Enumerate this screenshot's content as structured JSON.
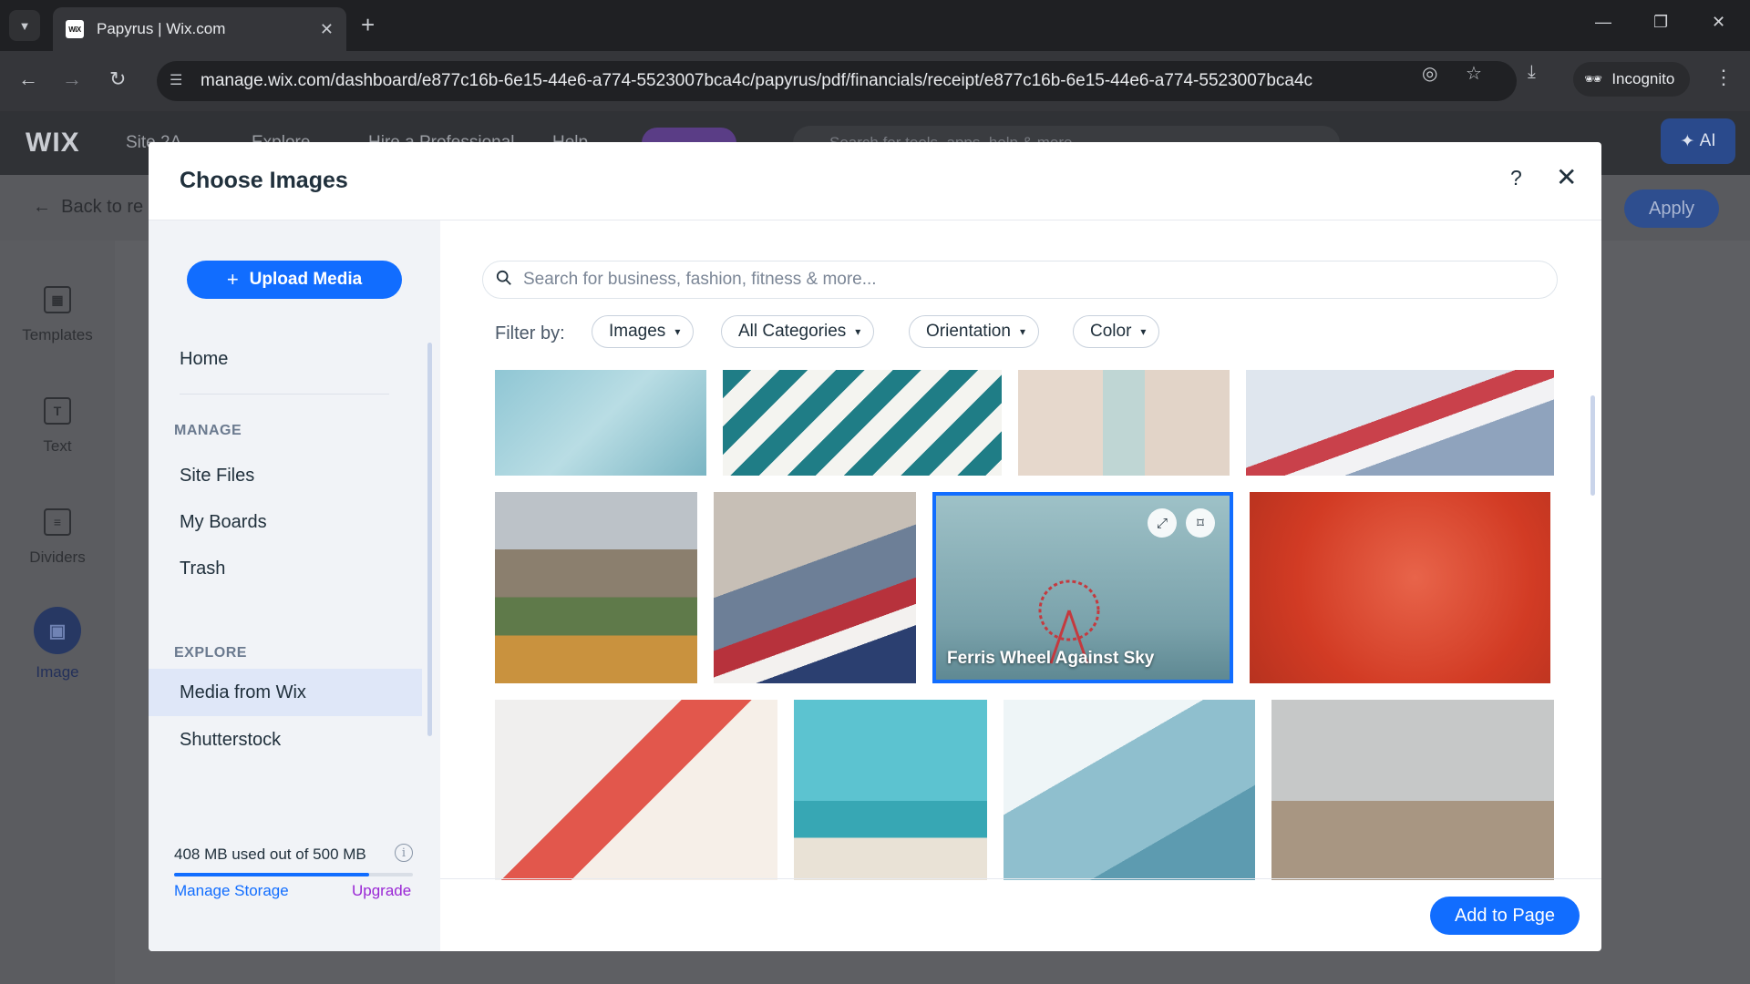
{
  "browser": {
    "tab_title": "Papyrus | Wix.com",
    "favicon_text": "WiX",
    "url": "manage.wix.com/dashboard/e877c16b-6e15-44e6-a774-5523007bca4c/papyrus/pdf/financials/receipt/e877c16b-6e15-44e6-a774-5523007bca4c",
    "profile_label": "Incognito"
  },
  "editor": {
    "logo": "WIX",
    "menu_items": [
      "Site 2A",
      "Explore",
      "Hire a Professional",
      "Help"
    ],
    "search_placeholder": "Search for tools, apps, help & more...",
    "ai_label": "AI",
    "back_label": "Back to re",
    "apply_label": "Apply",
    "sidebar": [
      {
        "label": "Templates",
        "icon": "templates-icon"
      },
      {
        "label": "Text",
        "icon": "text-icon"
      },
      {
        "label": "Dividers",
        "icon": "dividers-icon"
      },
      {
        "label": "Image",
        "icon": "image-icon"
      }
    ]
  },
  "modal": {
    "title": "Choose Images",
    "upload_label": "Upload Media",
    "nav": {
      "home": "Home",
      "manage_section": "MANAGE",
      "site_files": "Site Files",
      "my_boards": "My Boards",
      "trash": "Trash",
      "explore_section": "EXPLORE",
      "media_from_wix": "Media from Wix",
      "shutterstock": "Shutterstock"
    },
    "storage": {
      "text": "408 MB used out of 500 MB",
      "used_fraction": 0.816,
      "manage_label": "Manage Storage",
      "upgrade_label": "Upgrade"
    },
    "search_placeholder": "Search for business, fashion, fitness & more...",
    "filter_label": "Filter by:",
    "filters": [
      "Images",
      "All Categories",
      "Orientation",
      "Color"
    ],
    "selected_caption": "Ferris Wheel Against Sky",
    "add_label": "Add to Page"
  },
  "colors": {
    "accent": "#116dff",
    "upgrade": "#9a27d5",
    "overlay": "#5e5f63"
  }
}
